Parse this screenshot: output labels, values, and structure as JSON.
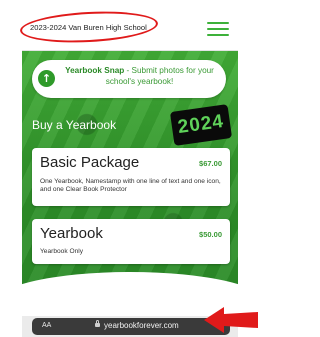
{
  "header": {
    "school_title": "2023-2024 Van Buren High School",
    "menu_icon": "hamburger-menu-icon"
  },
  "snap_banner": {
    "icon": "arrow-up-icon",
    "bold": "Yearbook Snap",
    "text": " - Submit photos for your school's yearbook!"
  },
  "section": {
    "title": "Buy a Yearbook",
    "badge": "2024"
  },
  "packages": [
    {
      "name": "Basic Package",
      "price": "$67.00",
      "description": "One Yearbook, Namestamp with one line of text and one icon, and one Clear Book Protector"
    },
    {
      "name": "Yearbook",
      "price": "$50.00",
      "description": "Yearbook Only"
    }
  ],
  "browser": {
    "text_size_label": "AA",
    "lock_icon": "lock-icon",
    "url": "yearbookforever.com"
  },
  "annotations": {
    "highlight_color": "#e01a1a"
  },
  "colors": {
    "brand_green": "#2f9a2a",
    "accent_green": "#3db13a"
  }
}
